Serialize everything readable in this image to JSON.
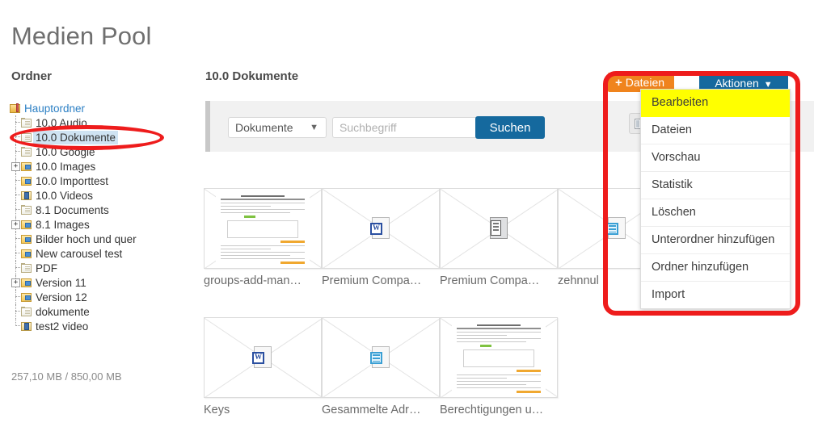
{
  "page": {
    "title": "Medien Pool"
  },
  "sidebar": {
    "heading": "Ordner",
    "storage": "257,10 MB / 850,00 MB",
    "tree": [
      {
        "label": "Hauptordner",
        "icon": "main-folder-icon",
        "level": 0,
        "expander": "",
        "link": true,
        "selected": false
      },
      {
        "label": "10.0 Audio",
        "icon": "document-folder-icon",
        "level": 1,
        "expander": "",
        "link": false,
        "selected": false
      },
      {
        "label": "10.0 Dokumente",
        "icon": "document-folder-icon",
        "level": 1,
        "expander": "",
        "link": false,
        "selected": true
      },
      {
        "label": "10.0 Google",
        "icon": "document-folder-icon",
        "level": 1,
        "expander": "",
        "link": false,
        "selected": false
      },
      {
        "label": "10.0 Images",
        "icon": "image-folder-icon",
        "level": 1,
        "expander": "+",
        "link": false,
        "selected": false
      },
      {
        "label": "10.0 Importtest",
        "icon": "image-folder-icon",
        "level": 1,
        "expander": "",
        "link": false,
        "selected": false
      },
      {
        "label": "10.0 Videos",
        "icon": "video-folder-icon",
        "level": 1,
        "expander": "",
        "link": false,
        "selected": false
      },
      {
        "label": "8.1 Documents",
        "icon": "document-folder-icon",
        "level": 1,
        "expander": "",
        "link": false,
        "selected": false
      },
      {
        "label": "8.1 Images",
        "icon": "image-folder-icon",
        "level": 1,
        "expander": "+",
        "link": false,
        "selected": false
      },
      {
        "label": "Bilder hoch und quer",
        "icon": "image-folder-icon",
        "level": 1,
        "expander": "",
        "link": false,
        "selected": false
      },
      {
        "label": "New carousel test",
        "icon": "image-folder-icon",
        "level": 1,
        "expander": "",
        "link": false,
        "selected": false
      },
      {
        "label": "PDF",
        "icon": "document-folder-icon",
        "level": 1,
        "expander": "",
        "link": false,
        "selected": false
      },
      {
        "label": "Version 11",
        "icon": "image-folder-icon",
        "level": 1,
        "expander": "+",
        "link": false,
        "selected": false
      },
      {
        "label": "Version 12",
        "icon": "image-folder-icon",
        "level": 1,
        "expander": "",
        "link": false,
        "selected": false
      },
      {
        "label": "dokumente",
        "icon": "document-folder-icon",
        "level": 1,
        "expander": "",
        "link": false,
        "selected": false
      },
      {
        "label": "test2 video",
        "icon": "video-folder-icon",
        "level": 1,
        "expander": "",
        "link": false,
        "selected": false
      }
    ]
  },
  "main": {
    "breadcrumb": "10.0 Dokumente",
    "toolbar": {
      "files_button": "Dateien",
      "files_button_plus": "+",
      "actions_button": "Aktionen",
      "actions_caret": "⌄",
      "view_toggle_icon": "list-view-icon"
    },
    "search": {
      "select_value": "Dokumente",
      "select_caret": "⌄",
      "placeholder": "Suchbegriff",
      "input_value": "",
      "submit_label": "Suchen"
    },
    "files": [
      {
        "caption": "groups-add-man…",
        "preview": "document-page",
        "row": 0,
        "col": 0
      },
      {
        "caption": "Premium Compa…",
        "preview": "word-file-icon",
        "row": 0,
        "col": 1
      },
      {
        "caption": "Premium Compa…",
        "preview": "zip-file-icon",
        "row": 0,
        "col": 2
      },
      {
        "caption": "zehnnul",
        "preview": "excel-file-icon",
        "row": 0,
        "col": 3
      },
      {
        "caption": "Keys",
        "preview": "word-file-icon",
        "row": 1,
        "col": 0
      },
      {
        "caption": "Gesammelte Adr…",
        "preview": "excel-file-icon",
        "row": 1,
        "col": 1
      },
      {
        "caption": "Berechtigungen u…",
        "preview": "document-page",
        "row": 1,
        "col": 2
      }
    ]
  },
  "dropdown": {
    "items": [
      {
        "label": "Bearbeiten",
        "highlight": true
      },
      {
        "label": "Dateien",
        "highlight": false
      },
      {
        "label": "Vorschau",
        "highlight": false
      },
      {
        "label": "Statistik",
        "highlight": false
      },
      {
        "label": "Löschen",
        "highlight": false
      },
      {
        "label": "Unterordner hinzufügen",
        "highlight": false
      },
      {
        "label": "Ordner hinzufügen",
        "highlight": false
      },
      {
        "label": "Import",
        "highlight": false
      }
    ]
  },
  "annotations": {
    "color": "#ee1c1c",
    "oval_target": "10.0 Dokumente",
    "rect_target": "Aktionen dropdown menu"
  },
  "colors": {
    "accent_orange": "#f0841d",
    "accent_blue": "#15699e",
    "highlight_yellow": "#ffff00",
    "selection_blue": "#cfe3f2",
    "annotation_red": "#ee1c1c"
  }
}
